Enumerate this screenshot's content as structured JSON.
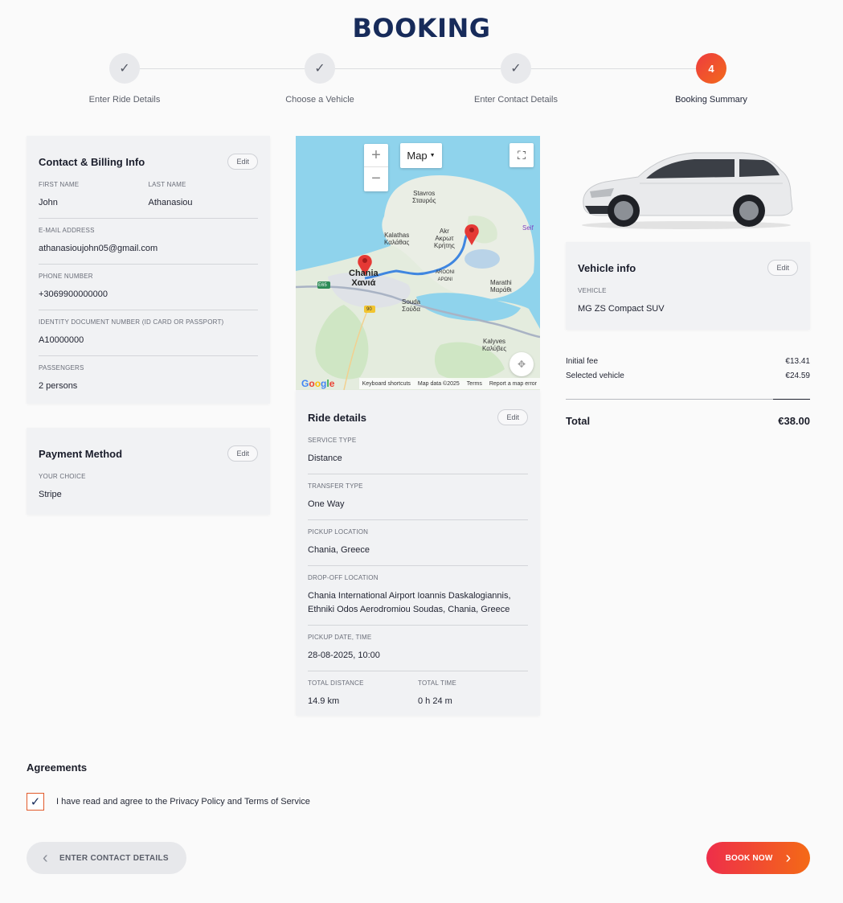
{
  "page": {
    "title": "BOOKING"
  },
  "steps": [
    {
      "label": "Enter Ride Details",
      "state": "done",
      "marker": "✓"
    },
    {
      "label": "Choose a Vehicle",
      "state": "done",
      "marker": "✓"
    },
    {
      "label": "Enter Contact Details",
      "state": "done",
      "marker": "✓"
    },
    {
      "label": "Booking Summary",
      "state": "active",
      "marker": "4"
    }
  ],
  "contact": {
    "title": "Contact & Billing Info",
    "edit_label": "Edit",
    "first_name_label": "FIRST NAME",
    "first_name": "John",
    "last_name_label": "LAST NAME",
    "last_name": "Athanasiou",
    "email_label": "E-MAIL ADDRESS",
    "email": "athanasioujohn05@gmail.com",
    "phone_label": "PHONE NUMBER",
    "phone": "+3069900000000",
    "id_label": "IDENTITY DOCUMENT NUMBER (ID CARD OR PASSPORT)",
    "id_number": "A10000000",
    "passengers_label": "PASSENGERS",
    "passengers": "2 persons"
  },
  "payment": {
    "title": "Payment Method",
    "edit_label": "Edit",
    "choice_label": "YOUR CHOICE",
    "choice": "Stripe"
  },
  "map": {
    "type_label": "Map",
    "zoom_in": "+",
    "zoom_out": "−",
    "fullscreen_icon": "fullscreen-icon",
    "labels": {
      "stavros": "Stavros\nΣταυρός",
      "kalathas": "Kalathas\nΚαλάθας",
      "akrotiri": "Akr\nΑκρωτ\nΚρήτης",
      "chania": "Chania\nΧανιά",
      "arooni": "AROONI\nΑΡΩΝΙ",
      "marathi": "Marathi\nΜαράθι",
      "souda": "Souda\nΣούδα",
      "kalyves": "Kalyves\nΚαλύβες",
      "seif": "Seif",
      "e65": "E65",
      "route90": "90"
    },
    "google": [
      "G",
      "o",
      "o",
      "g",
      "l",
      "e"
    ],
    "shortcuts": "Keyboard shortcuts",
    "map_data": "Map data ©2025",
    "terms": "Terms",
    "report": "Report a map error"
  },
  "ride": {
    "title": "Ride details",
    "edit_label": "Edit",
    "service_type_label": "SERVICE TYPE",
    "service_type": "Distance",
    "transfer_type_label": "TRANSFER TYPE",
    "transfer_type": "One Way",
    "pickup_label": "PICKUP LOCATION",
    "pickup": "Chania, Greece",
    "dropoff_label": "DROP-OFF LOCATION",
    "dropoff": "Chania International Airport Ioannis Daskalogiannis, Ethniki Odos Aerodromiou Soudas, Chania, Greece",
    "datetime_label": "PICKUP DATE, TIME",
    "datetime": "28-08-2025, 10:00",
    "distance_label": "TOTAL DISTANCE",
    "distance": "14.9 km",
    "time_label": "TOTAL TIME",
    "time": "0 h 24 m"
  },
  "vehicle": {
    "title": "Vehicle info",
    "edit_label": "Edit",
    "vehicle_label": "VEHICLE",
    "vehicle": "MG ZS Compact SUV"
  },
  "totals": {
    "initial_fee_label": "Initial fee",
    "initial_fee": "€13.41",
    "selected_vehicle_label": "Selected vehicle",
    "selected_vehicle": "€24.59",
    "total_label": "Total",
    "total": "€38.00"
  },
  "agreements": {
    "title": "Agreements",
    "text": "I have read and agree to the Privacy Policy and Terms of Service",
    "checked": true
  },
  "buttons": {
    "back": "ENTER CONTACT DETAILS",
    "book": "BOOK NOW"
  },
  "colors": {
    "brand_navy": "#172b5a",
    "accent_start": "#ee2e4a",
    "accent_end": "#f46a16"
  }
}
